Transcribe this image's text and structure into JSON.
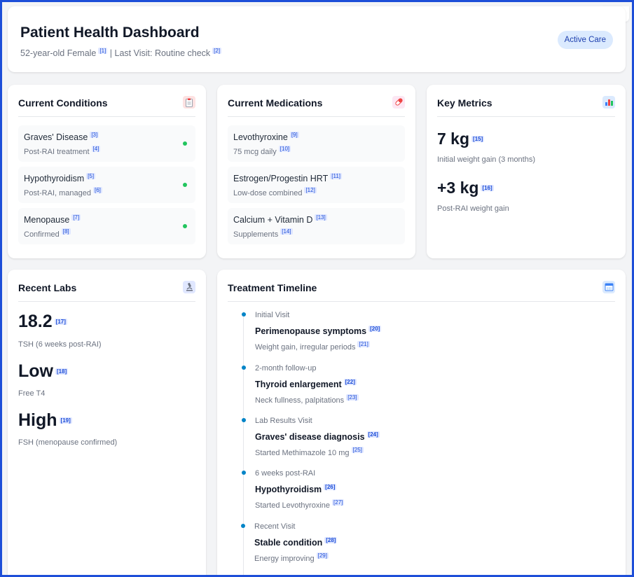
{
  "header": {
    "title": "Patient Health Dashboard",
    "subtitle_part1": "52-year-old Female",
    "cite1": "[1]",
    "separator": "|",
    "subtitle_part2": "Last Visit: Routine check",
    "cite2": "[2]",
    "status_badge": "Active Care"
  },
  "conditions": {
    "title": "Current Conditions",
    "icon": "clipboard-icon",
    "items": [
      {
        "name": "Graves' Disease",
        "name_cite": "[3]",
        "detail": "Post-RAI treatment",
        "detail_cite": "[4]"
      },
      {
        "name": "Hypothyroidism",
        "name_cite": "[5]",
        "detail": "Post-RAI, managed",
        "detail_cite": "[6]"
      },
      {
        "name": "Menopause",
        "name_cite": "[7]",
        "detail": "Confirmed",
        "detail_cite": "[8]"
      }
    ],
    "status_color": "#22c55e"
  },
  "medications": {
    "title": "Current Medications",
    "icon": "pill-icon",
    "items": [
      {
        "name": "Levothyroxine",
        "name_cite": "[9]",
        "detail": "75 mcg daily",
        "detail_cite": "[10]"
      },
      {
        "name": "Estrogen/Progestin HRT",
        "name_cite": "[11]",
        "detail": "Low-dose combined",
        "detail_cite": "[12]"
      },
      {
        "name": "Calcium + Vitamin D",
        "name_cite": "[13]",
        "detail": "Supplements",
        "detail_cite": "[14]"
      }
    ]
  },
  "metrics": {
    "title": "Key Metrics",
    "icon": "bar-chart-icon",
    "items": [
      {
        "value": "7 kg",
        "cite": "[15]",
        "label": "Initial weight gain (3 months)"
      },
      {
        "value": "+3 kg",
        "cite": "[16]",
        "label": "Post-RAI weight gain"
      }
    ]
  },
  "labs": {
    "title": "Recent Labs",
    "icon": "microscope-icon",
    "items": [
      {
        "value": "18.2",
        "cite": "[17]",
        "label": "TSH (6 weeks post-RAI)"
      },
      {
        "value": "Low",
        "cite": "[18]",
        "label": "Free T4"
      },
      {
        "value": "High",
        "cite": "[19]",
        "label": "FSH (menopause confirmed)"
      }
    ]
  },
  "timeline": {
    "title": "Treatment Timeline",
    "icon": "calendar-icon",
    "events": [
      {
        "date": "Initial Visit",
        "title": "Perimenopause symptoms",
        "title_cite": "[20]",
        "desc": "Weight gain, irregular periods",
        "desc_cite": "[21]"
      },
      {
        "date": "2-month follow-up",
        "title": "Thyroid enlargement",
        "title_cite": "[22]",
        "desc": "Neck fullness, palpitations",
        "desc_cite": "[23]"
      },
      {
        "date": "Lab Results Visit",
        "title": "Graves' disease diagnosis",
        "title_cite": "[24]",
        "desc": "Started Methimazole 10 mg",
        "desc_cite": "[25]"
      },
      {
        "date": "6 weeks post-RAI",
        "title": "Hypothyroidism",
        "title_cite": "[26]",
        "desc": "Started Levothyroxine",
        "desc_cite": "[27]"
      },
      {
        "date": "Recent Visit",
        "title": "Stable condition",
        "title_cite": "[28]",
        "desc": "Energy improving",
        "desc_cite": "[29]"
      }
    ],
    "dot_color": "#0284c7"
  },
  "colors": {
    "accent": "#1d4ed8",
    "badge_bg": "#dbeafe",
    "badge_text": "#1e40af"
  }
}
